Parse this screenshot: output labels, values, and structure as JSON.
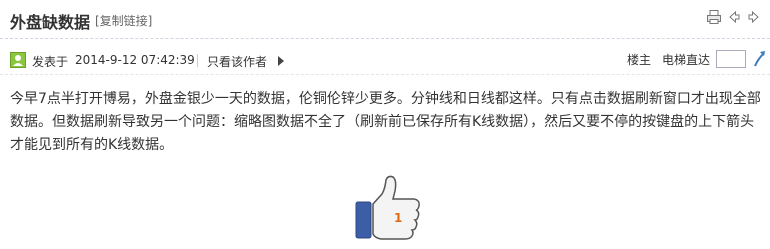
{
  "header": {
    "title": "外盘缺数据",
    "copy_link": "[复制链接]"
  },
  "meta": {
    "posted_label": "发表于",
    "timestamp": "2014-9-12 07:42:39",
    "only_author": "只看该作者",
    "floor_label": "楼主",
    "elevator_label": "电梯直达",
    "floor_input_value": ""
  },
  "post": {
    "body": "今早7点半打开博易，外盘金银少一天的数据，伦铜伦锌少更多。分钟线和日线都这样。只有点击数据刷新窗口才出现全部数据。但数据刷新导致另一个问题：缩略图数据不全了（刷新前已保存所有K线数据），然后又要不停的按键盘的上下箭头才能见到所有的K线数据。"
  },
  "like": {
    "count": "1"
  },
  "icons": {
    "print": "print-icon",
    "prev": "prev-icon",
    "next": "next-icon",
    "user": "user-icon",
    "go": "go-icon"
  }
}
